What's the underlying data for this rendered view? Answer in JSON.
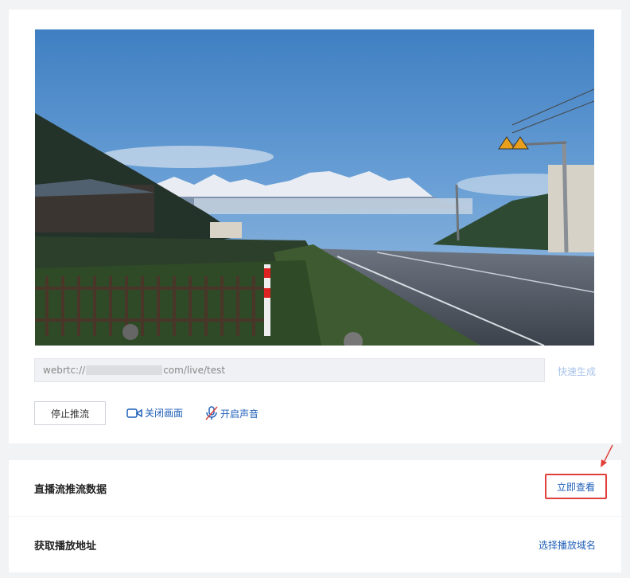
{
  "stream": {
    "url_prefix": "webrtc://",
    "url_suffix": "com/live/test",
    "quick_generate": "快速生成"
  },
  "controls": {
    "stop_push": "停止推流",
    "close_video": "关闭画面",
    "open_audio": "开启声音"
  },
  "sections": {
    "push_data_title": "直播流推流数据",
    "view_now": "立即查看",
    "get_play_address": "获取播放地址",
    "select_domain": "选择播放域名"
  },
  "colors": {
    "link_blue": "#1f5fb8",
    "highlight_red": "#e0403a"
  }
}
